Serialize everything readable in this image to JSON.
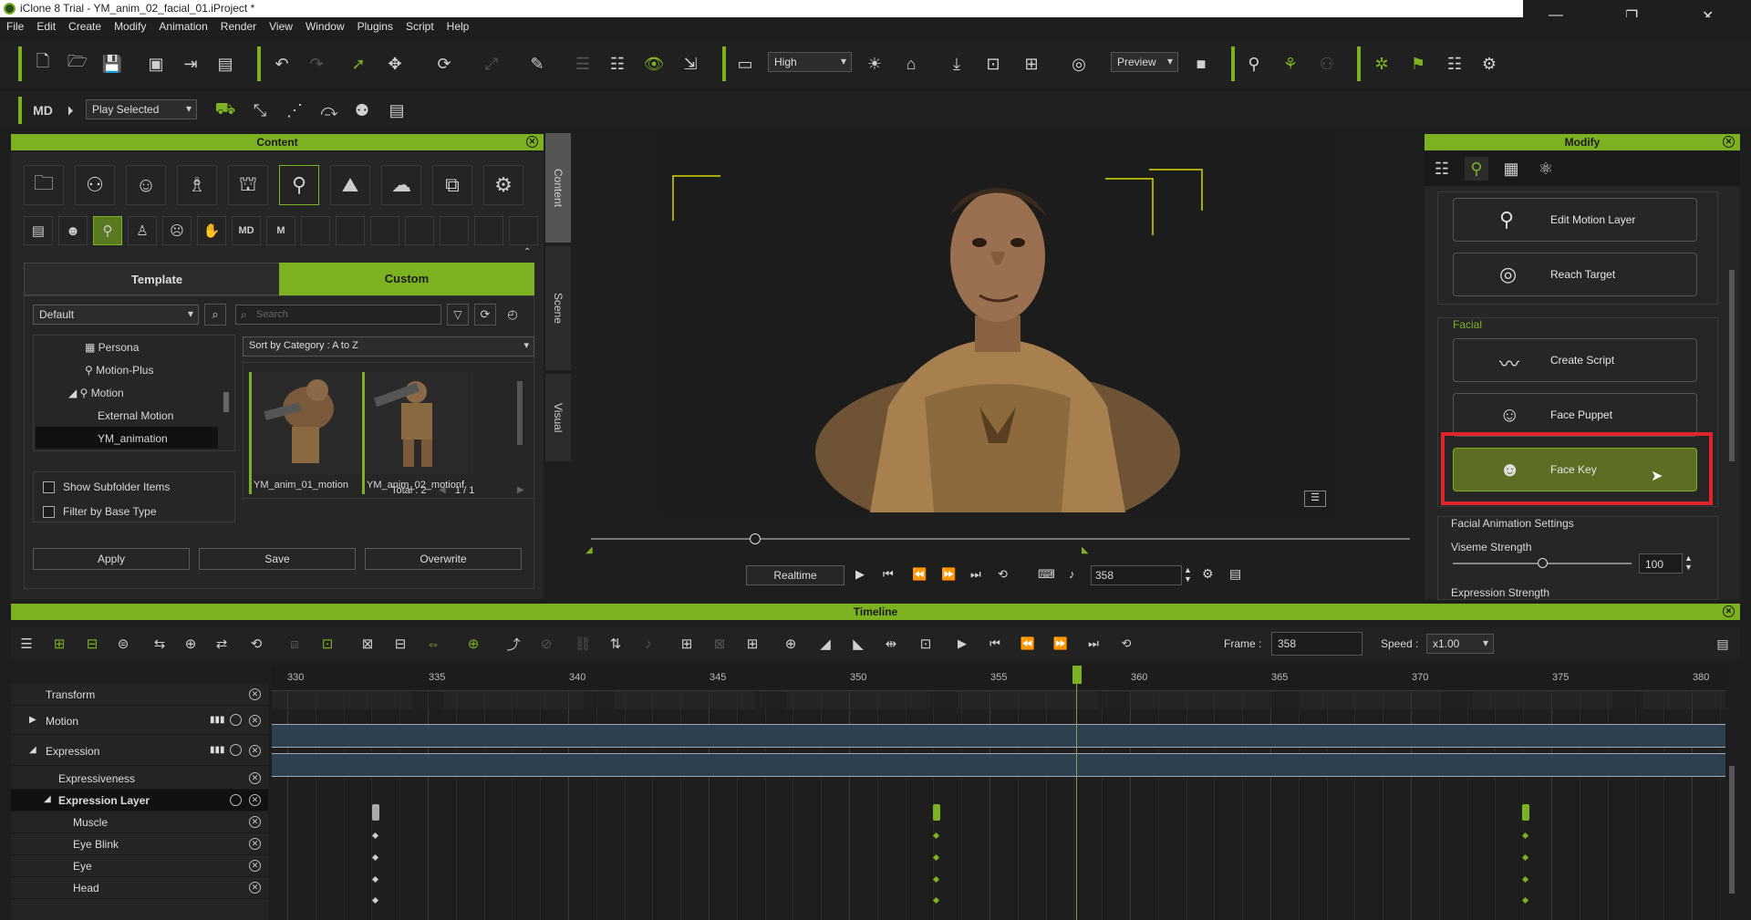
{
  "window": {
    "title": "iClone 8 Trial - YM_anim_02_facial_01.iProject *",
    "controls": [
      "—",
      "❐",
      "✕"
    ]
  },
  "menu": [
    "File",
    "Edit",
    "Create",
    "Modify",
    "Animation",
    "Render",
    "View",
    "Window",
    "Plugins",
    "Script",
    "Help"
  ],
  "toolbar": {
    "quality": "High",
    "preview": "Preview",
    "play_mode": "Play Selected"
  },
  "content": {
    "title": "Content",
    "tab_template": "Template",
    "tab_custom": "Custom",
    "folder_select": "Default",
    "search_placeholder": "Search",
    "sort": "Sort by Category : A to Z",
    "tree": [
      "Persona",
      "Motion-Plus",
      "Motion",
      "External Motion",
      "YM_animation"
    ],
    "thumbs": [
      "YM_anim_01_motion",
      "YM_anim_02_motionf"
    ],
    "total": "Total : 2",
    "page": "1  /  1",
    "show_subfolder": "Show Subfolder Items",
    "filter_base": "Filter by Base Type",
    "apply": "Apply",
    "save": "Save",
    "overwrite": "Overwrite",
    "side_tabs": [
      "Content",
      "Scene",
      "Visual"
    ]
  },
  "viewport": {
    "realtime": "Realtime",
    "frame": "358"
  },
  "modify": {
    "title": "Modify",
    "edit_motion_layer": "Edit Motion Layer",
    "reach_target": "Reach Target",
    "facial_label": "Facial",
    "create_script": "Create Script",
    "face_puppet": "Face Puppet",
    "face_key": "Face Key",
    "facial_settings": "Facial Animation Settings",
    "viseme_strength": "Viseme Strength",
    "viseme_value": "100",
    "viseme_level": 0.5,
    "expression_strength": "Expression Strength"
  },
  "timeline": {
    "title": "Timeline",
    "frame_label": "Frame :",
    "frame_value": "358",
    "speed_label": "Speed :",
    "speed_value": "x1.00",
    "ruler": [
      "330",
      "335",
      "340",
      "345",
      "350",
      "355",
      "360",
      "365",
      "370",
      "375",
      "380"
    ],
    "tracks": [
      "Transform",
      "Motion",
      "Expression",
      "Expressiveness",
      "Expression Layer",
      "Muscle",
      "Eye Blink",
      "Eye",
      "Head"
    ]
  },
  "colors": {
    "accent": "#7cb221",
    "highlight_box": "#e0242c"
  }
}
